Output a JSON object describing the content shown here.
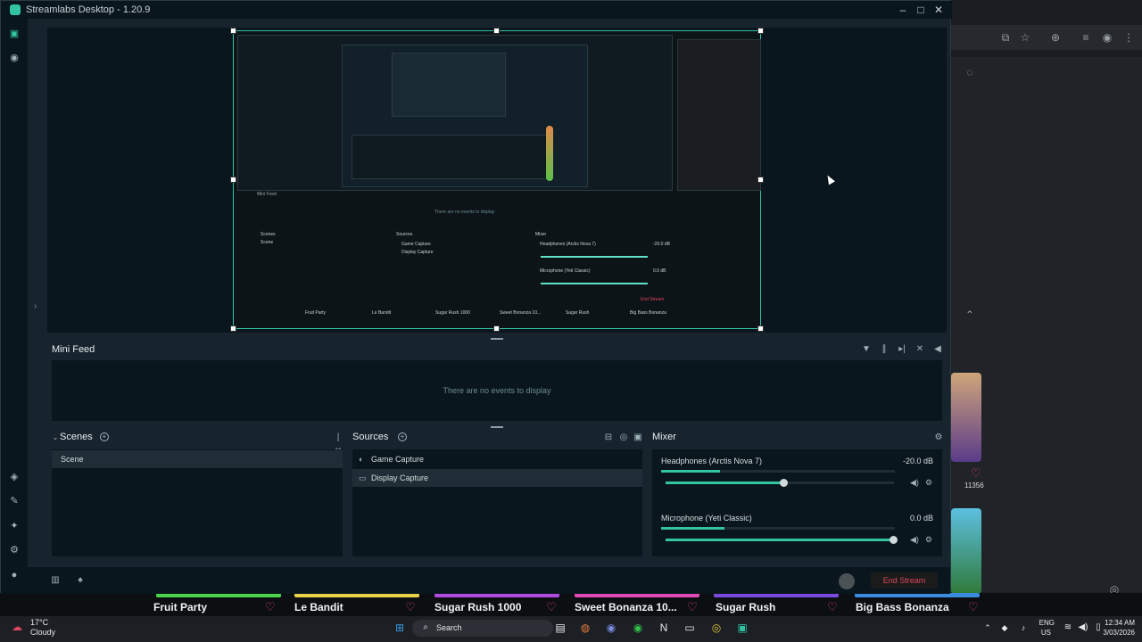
{
  "window": {
    "title": "Streamlabs Desktop - 1.20.9"
  },
  "minifeed": {
    "title": "Mini Feed",
    "empty_text": "There are no events to display"
  },
  "scenes": {
    "title": "Scenes",
    "items": [
      "Scene"
    ]
  },
  "sources": {
    "title": "Sources",
    "items": [
      "Game Capture",
      "Display Capture"
    ]
  },
  "mixer": {
    "title": "Mixer",
    "tracks": [
      {
        "name": "Headphones (Arctis Nova 7)",
        "db": "-20.0 dB",
        "level": 0.25,
        "fader": 0.52
      },
      {
        "name": "Microphone (Yeti Classic)",
        "db": "0.0 dB",
        "level": 0.27,
        "fader": 1.0
      }
    ]
  },
  "footer": {
    "end_stream": "End Stream"
  },
  "games": [
    {
      "name": "Fruit Party"
    },
    {
      "name": "Le Bandit"
    },
    {
      "name": "Sugar Rush 1000"
    },
    {
      "name": "Sweet Bonanza 10..."
    },
    {
      "name": "Sugar Rush"
    },
    {
      "name": "Big Bass Bonanza"
    }
  ],
  "side_count": "11356",
  "taskbar": {
    "weather_temp": "17°C",
    "weather_desc": "Cloudy",
    "search": "Search",
    "lang_top": "ENG",
    "lang_bottom": "US",
    "time": "12:34 AM",
    "date": "3/03/2026"
  },
  "nested_preview": {
    "minifeed": "Mini Feed",
    "empty": "There are no events to display",
    "scenes": "Scenes",
    "scene": "Scene",
    "sources": "Sources",
    "src1": "Game Capture",
    "src2": "Display Capture",
    "mixer": "Mixer",
    "track1": "Headphones (Arctis Nova 7)",
    "db1": "-20.0 dB",
    "track2": "Microphone (Yeti Classic)",
    "db2": "0.0 dB",
    "end": "End Stream",
    "games": [
      "Fruit Party",
      "Le Bandit",
      "Sugar Rush 1000",
      "Sweet Bonanza 10...",
      "Sugar Rush",
      "Big Bass Bonanza"
    ]
  }
}
